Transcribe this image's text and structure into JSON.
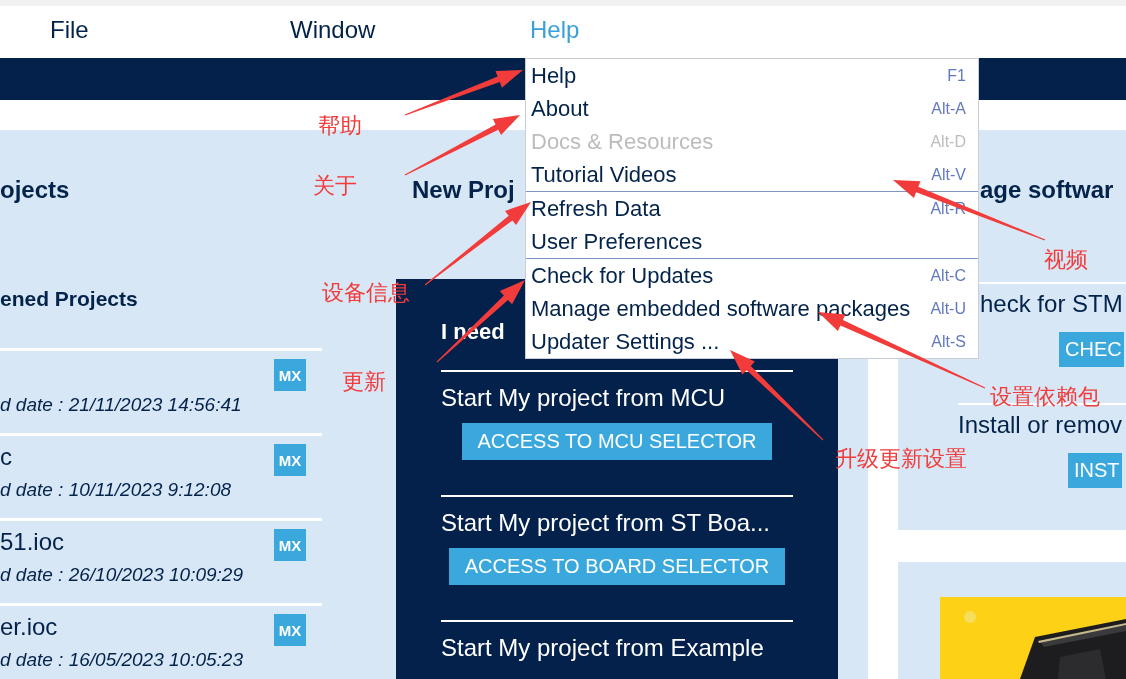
{
  "menubar": [
    {
      "label": "File",
      "open": false
    },
    {
      "label": "Window",
      "open": false
    },
    {
      "label": "Help",
      "open": true
    }
  ],
  "recent_projects": {
    "title": "ojects",
    "subtitle": "ened Projects",
    "rows": [
      {
        "badge": "MX",
        "date": "d date : 21/11/2023 14:56:41"
      },
      {
        "name": "c",
        "badge": "MX",
        "date": "d date : 10/11/2023 9:12:08"
      },
      {
        "name": "51.ioc",
        "badge": "MX",
        "date": "d date : 26/10/2023 10:09:29"
      },
      {
        "name": "er.ioc",
        "badge": "MX",
        "date": "d date : 16/05/2023 10:05:23"
      }
    ]
  },
  "new_project": {
    "title": "New Proj",
    "panel_title": "I need",
    "options": [
      {
        "text": "Start My project from MCU",
        "button": "ACCESS TO MCU SELECTOR"
      },
      {
        "text": "Start My project from ST Boa...",
        "button": "ACCESS TO BOARD SELECTOR"
      },
      {
        "text": "Start My project from Example"
      }
    ]
  },
  "manage_software": {
    "title": "age softwar",
    "sections": [
      {
        "text": "heck for STM",
        "button": "CHEC"
      },
      {
        "text": "Install or remov",
        "button": "INST"
      }
    ]
  },
  "help_menu": {
    "items": [
      {
        "label": "Help",
        "shortcut": "F1",
        "disabled": false,
        "separator_after": false
      },
      {
        "label": "About",
        "shortcut": "Alt-A",
        "disabled": false,
        "separator_after": false
      },
      {
        "label": "Docs & Resources",
        "shortcut": "Alt-D",
        "disabled": true,
        "separator_after": false
      },
      {
        "label": "Tutorial Videos",
        "shortcut": "Alt-V",
        "disabled": false,
        "separator_after": true
      },
      {
        "label": "Refresh Data",
        "shortcut": "Alt-R",
        "disabled": false,
        "separator_after": false
      },
      {
        "label": "User Preferences",
        "disabled": false,
        "separator_after": true
      },
      {
        "label": "Check for Updates",
        "shortcut": "Alt-C",
        "disabled": false,
        "separator_after": false
      },
      {
        "label": "Manage embedded software packages",
        "shortcut": "Alt-U",
        "disabled": false,
        "separator_after": false
      },
      {
        "label": "Updater Settings ...",
        "shortcut": "Alt-S",
        "disabled": false,
        "separator_after": false
      }
    ]
  },
  "annotations": [
    {
      "label": "帮助"
    },
    {
      "label": "关于"
    },
    {
      "label": "视频"
    },
    {
      "label": "设备信息"
    },
    {
      "label": "更新"
    },
    {
      "label": "设置依赖包"
    },
    {
      "label": "升级更新设置"
    }
  ]
}
